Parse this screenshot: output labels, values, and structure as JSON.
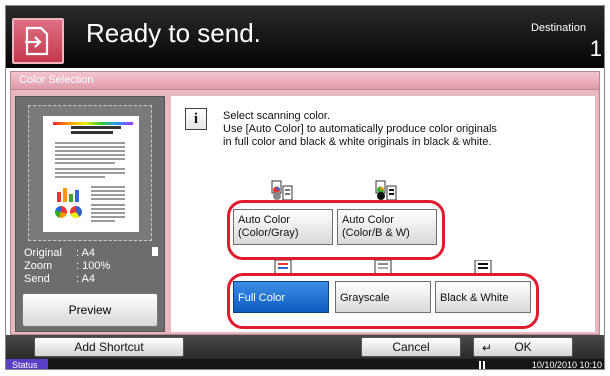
{
  "header": {
    "title": "Ready to send.",
    "destination_label": "Destination",
    "destination_count": "1",
    "icon": "send-icon"
  },
  "panel": {
    "title": "Color Selection",
    "message": [
      "Select scanning color.",
      "Use [Auto Color] to automatically produce color originals",
      "in full color and black & white originals in black & white."
    ]
  },
  "preview": {
    "original_key": "Original",
    "original_value": ": A4",
    "zoom_key": "Zoom",
    "zoom_value": ": 100%",
    "send_key": "Send",
    "send_value": ": A4",
    "preview_label": "Preview",
    "doc_title": "The Working Name from Office 365 Event"
  },
  "options": {
    "auto_color_gray": "Auto Color (Color/Gray)",
    "auto_color_bw": "Auto Color (Color/B & W)",
    "full_color": "Full Color",
    "grayscale": "Grayscale",
    "black_white": "Black & White",
    "selected": "Full Color"
  },
  "footer": {
    "add_shortcut": "Add Shortcut",
    "cancel": "Cancel",
    "ok": "OK",
    "ok_icon": "enter-icon"
  },
  "statusbar": {
    "status": "Status",
    "datetime": "10/10/2010  10:10"
  },
  "colors": {
    "accent": "#d2485d",
    "highlight_ring": "#e01b2e",
    "selected": "#0b5bbf",
    "panel_bg": "#e8b7bf"
  }
}
